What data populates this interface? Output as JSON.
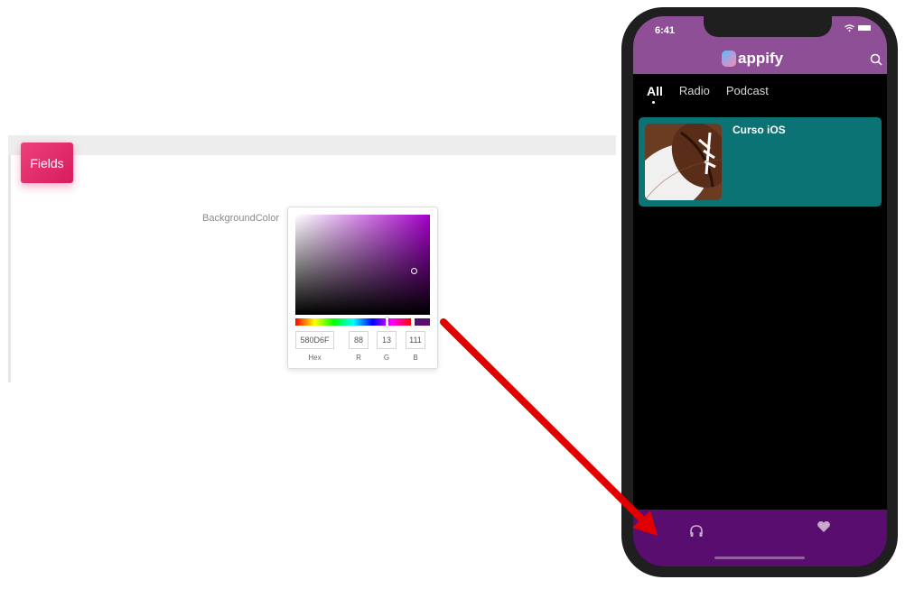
{
  "panel": {
    "fields_label": "Fields",
    "background_color_label": "BackgroundColor"
  },
  "color_picker": {
    "hex_value": "580D6F",
    "r_value": "88",
    "g_value": "13",
    "b_value": "111",
    "hex_label": "Hex",
    "r_label": "R",
    "g_label": "G",
    "b_label": "B",
    "selected_color": "#580D6F"
  },
  "phone": {
    "status_time": "6:41",
    "app_name": "appify",
    "header_color": "#8F4F97",
    "bottom_bar_color": "#590D6F",
    "tabs": [
      {
        "label": "All",
        "active": true
      },
      {
        "label": "Radio",
        "active": false
      },
      {
        "label": "Podcast",
        "active": false
      }
    ],
    "card": {
      "title": "Curso iOS",
      "color": "#0C7375"
    },
    "bottom_icons": [
      "headphones-icon",
      "heart-icon"
    ]
  },
  "arrow_color": "#E00000"
}
